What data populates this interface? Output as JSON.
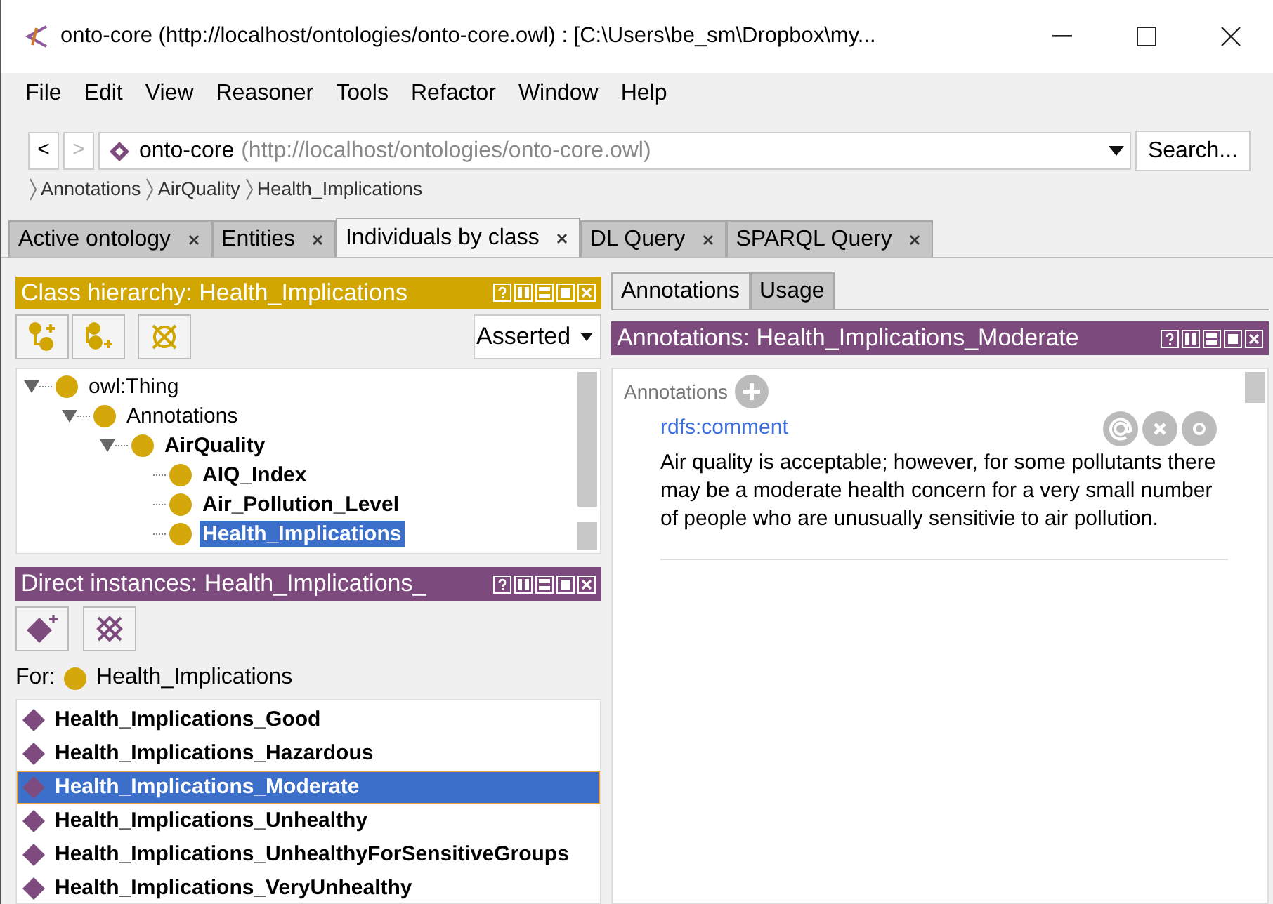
{
  "window": {
    "title": "onto-core (http://localhost/ontologies/onto-core.owl)  : [C:\\Users\\be_sm\\Dropbox\\my..."
  },
  "menu": [
    "File",
    "Edit",
    "View",
    "Reasoner",
    "Tools",
    "Refactor",
    "Window",
    "Help"
  ],
  "nav": {
    "back": {
      "label": "<",
      "disabled": false
    },
    "forward": {
      "label": ">",
      "disabled": true
    }
  },
  "address": {
    "name": "onto-core",
    "iri": "(http://localhost/ontologies/onto-core.owl)"
  },
  "search_button": "Search...",
  "breadcrumb": [
    "Annotations",
    "AirQuality",
    "Health_Implications"
  ],
  "tabs": [
    {
      "label": "Active ontology",
      "selected": false
    },
    {
      "label": "Entities",
      "selected": false
    },
    {
      "label": "Individuals by class",
      "selected": true
    },
    {
      "label": "DL Query",
      "selected": false
    },
    {
      "label": "SPARQL Query",
      "selected": false
    }
  ],
  "class_panel": {
    "title": "Class hierarchy: Health_Implications",
    "mode": "Asserted",
    "tree": [
      {
        "label": "owl:Thing",
        "bold": false,
        "selected": false,
        "expanded": true,
        "children": [
          {
            "label": "Annotations",
            "bold": false,
            "selected": false,
            "expanded": true,
            "children": [
              {
                "label": "AirQuality",
                "bold": true,
                "selected": false,
                "expanded": true,
                "children": [
                  {
                    "label": "AIQ_Index",
                    "bold": true,
                    "selected": false
                  },
                  {
                    "label": "Air_Pollution_Level",
                    "bold": true,
                    "selected": false
                  },
                  {
                    "label": "Health_Implications",
                    "bold": true,
                    "selected": true
                  }
                ]
              }
            ]
          }
        ]
      }
    ]
  },
  "instances_panel": {
    "title": "Direct instances: Health_Implications_",
    "for_label": "For:",
    "for_value": "Health_Implications",
    "items": [
      {
        "label": "Health_Implications_Good",
        "selected": false
      },
      {
        "label": "Health_Implications_Hazardous",
        "selected": false
      },
      {
        "label": "Health_Implications_Moderate",
        "selected": true
      },
      {
        "label": "Health_Implications_Unhealthy",
        "selected": false
      },
      {
        "label": "Health_Implications_UnhealthyForSensitiveGroups",
        "selected": false
      },
      {
        "label": "Health_Implications_VeryUnhealthy",
        "selected": false
      }
    ]
  },
  "right_tabs": [
    {
      "label": "Annotations",
      "selected": true
    },
    {
      "label": "Usage",
      "selected": false
    }
  ],
  "annotations_panel": {
    "title": "Annotations: Health_Implications_Moderate",
    "section_label": "Annotations",
    "annotations": [
      {
        "property": "rdfs:comment",
        "value": "Air quality is acceptable; however, for some pollutants there may be a moderate health concern for a very small number of people who are unusually sensitivie to air pollution."
      }
    ]
  }
}
